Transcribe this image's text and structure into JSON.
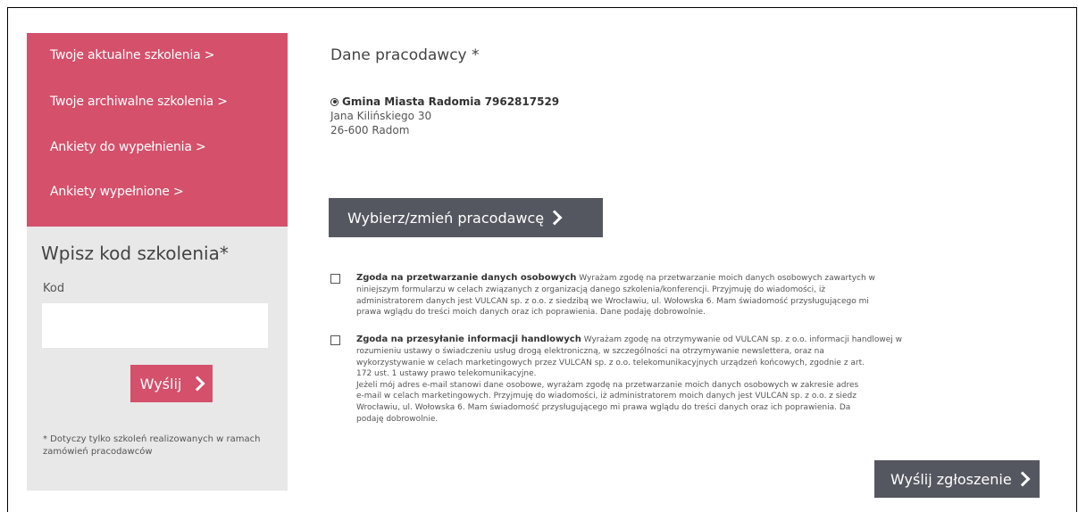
{
  "sidebar": {
    "nav_items": [
      {
        "label": "Twoje aktualne szkolenia >"
      },
      {
        "label": "Twoje archiwalne szkolenia >"
      },
      {
        "label": "Ankiety do wypełnienia >"
      },
      {
        "label": "Ankiety wypełnione >"
      }
    ],
    "code_title": "Wpisz kod szkolenia*",
    "code_label": "Kod",
    "code_value": "",
    "send_label": "Wyślij",
    "note": "* Dotyczy tylko szkoleń realizowanych w ramach zamówień pracodawców"
  },
  "employer": {
    "section_title": "Dane pracodawcy *",
    "name": "Gmina Miasta Radomia 7962817529",
    "street": "Jana Kilińskiego 30",
    "city": "26-600 Radom",
    "choose_label": "Wybierz/zmień pracodawcę"
  },
  "consents": [
    {
      "title": "Zgoda na przetwarzanie danych osobowych",
      "lines": [
        "Wyrażam zgodę na przetwarzanie moich danych osobowych zawartych w",
        "niniejszym formularzu w celach związanych z organizacją danego szkolenia/konferencji. Przyjmuję do wiadomości, iż",
        "administratorem danych jest VULCAN sp. z o.o. z siedzibą we Wrocławiu, ul. Wołowska 6. Mam świadomość przysługującego mi",
        "prawa wglądu do treści moich danych oraz ich poprawienia. Dane podaję dobrowolnie."
      ]
    },
    {
      "title": "Zgoda na przesyłanie informacji handlowych",
      "lines": [
        "Wyrażam zgodę na otrzymywanie od VULCAN sp. z o.o. informacji handlowej w",
        "rozumieniu ustawy o świadczeniu usług drogą elektroniczną, w szczególności na otrzymywanie newslettera, oraz na",
        "wykorzystywanie w celach marketingowych przez VULCAN sp. z o.o. telekomunikacyjnych urządzeń końcowych, zgodnie z art.",
        "172 ust. 1 ustawy prawo telekomunikacyjne.",
        "Jeżeli mój adres e-mail stanowi dane osobowe, wyrażam zgodę na przetwarzanie moich danych osobowych w zakresie adres",
        "e-mail w celach marketingowych. Przyjmuję do wiadomości, iż administratorem moich danych jest VULCAN sp. z o.o. z siedz",
        "Wrocławiu, ul. Wołowska 6. Mam świadomość przysługującego mi prawa wglądu do treści danych oraz ich poprawienia. Da",
        "podaję dobrowolnie."
      ]
    }
  ],
  "submit_label": "Wyślij zgłoszenie"
}
